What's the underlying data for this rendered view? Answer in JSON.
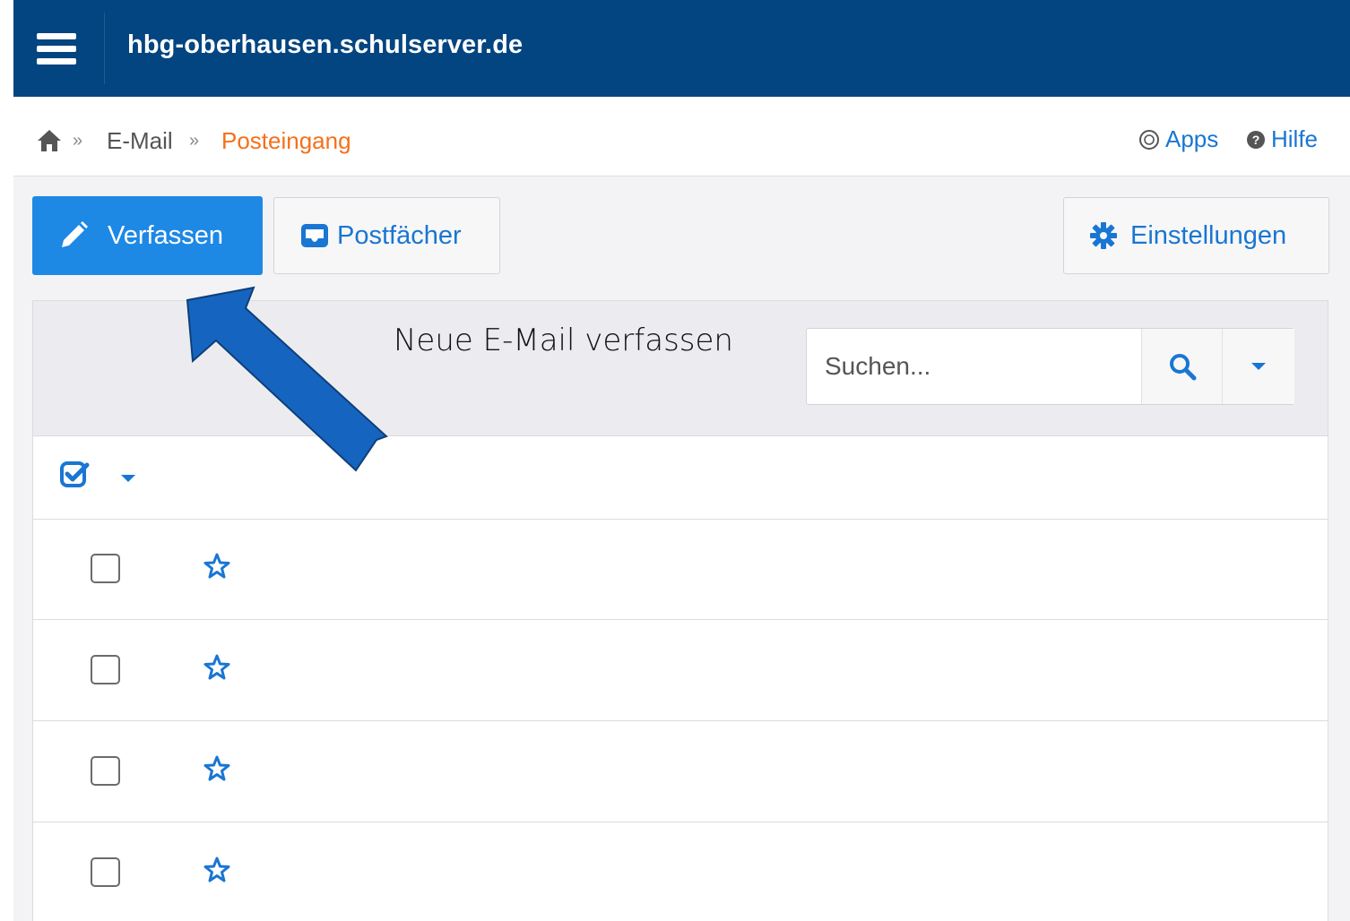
{
  "header": {
    "site_title": "hbg-oberhausen.schulserver.de"
  },
  "breadcrumb": {
    "separator": "»",
    "items": [
      "E-Mail",
      "Posteingang"
    ]
  },
  "top_links": {
    "apps": "Apps",
    "help": "Hilfe"
  },
  "toolbar": {
    "compose_label": "Verfassen",
    "mailboxes_label": "Postfächer",
    "settings_label": "Einstellungen"
  },
  "annotation": {
    "text": "Neue E-Mail verfassen"
  },
  "search": {
    "placeholder": "Suchen..."
  },
  "message_rows": [
    {
      "checked": false,
      "starred": false
    },
    {
      "checked": false,
      "starred": false
    },
    {
      "checked": false,
      "starred": false
    },
    {
      "checked": false,
      "starred": false
    }
  ],
  "colors": {
    "header_bg": "#034580",
    "accent": "#1e88e5",
    "breadcrumb_active": "#f5701a",
    "annotation_arrow": "#1565c0"
  }
}
